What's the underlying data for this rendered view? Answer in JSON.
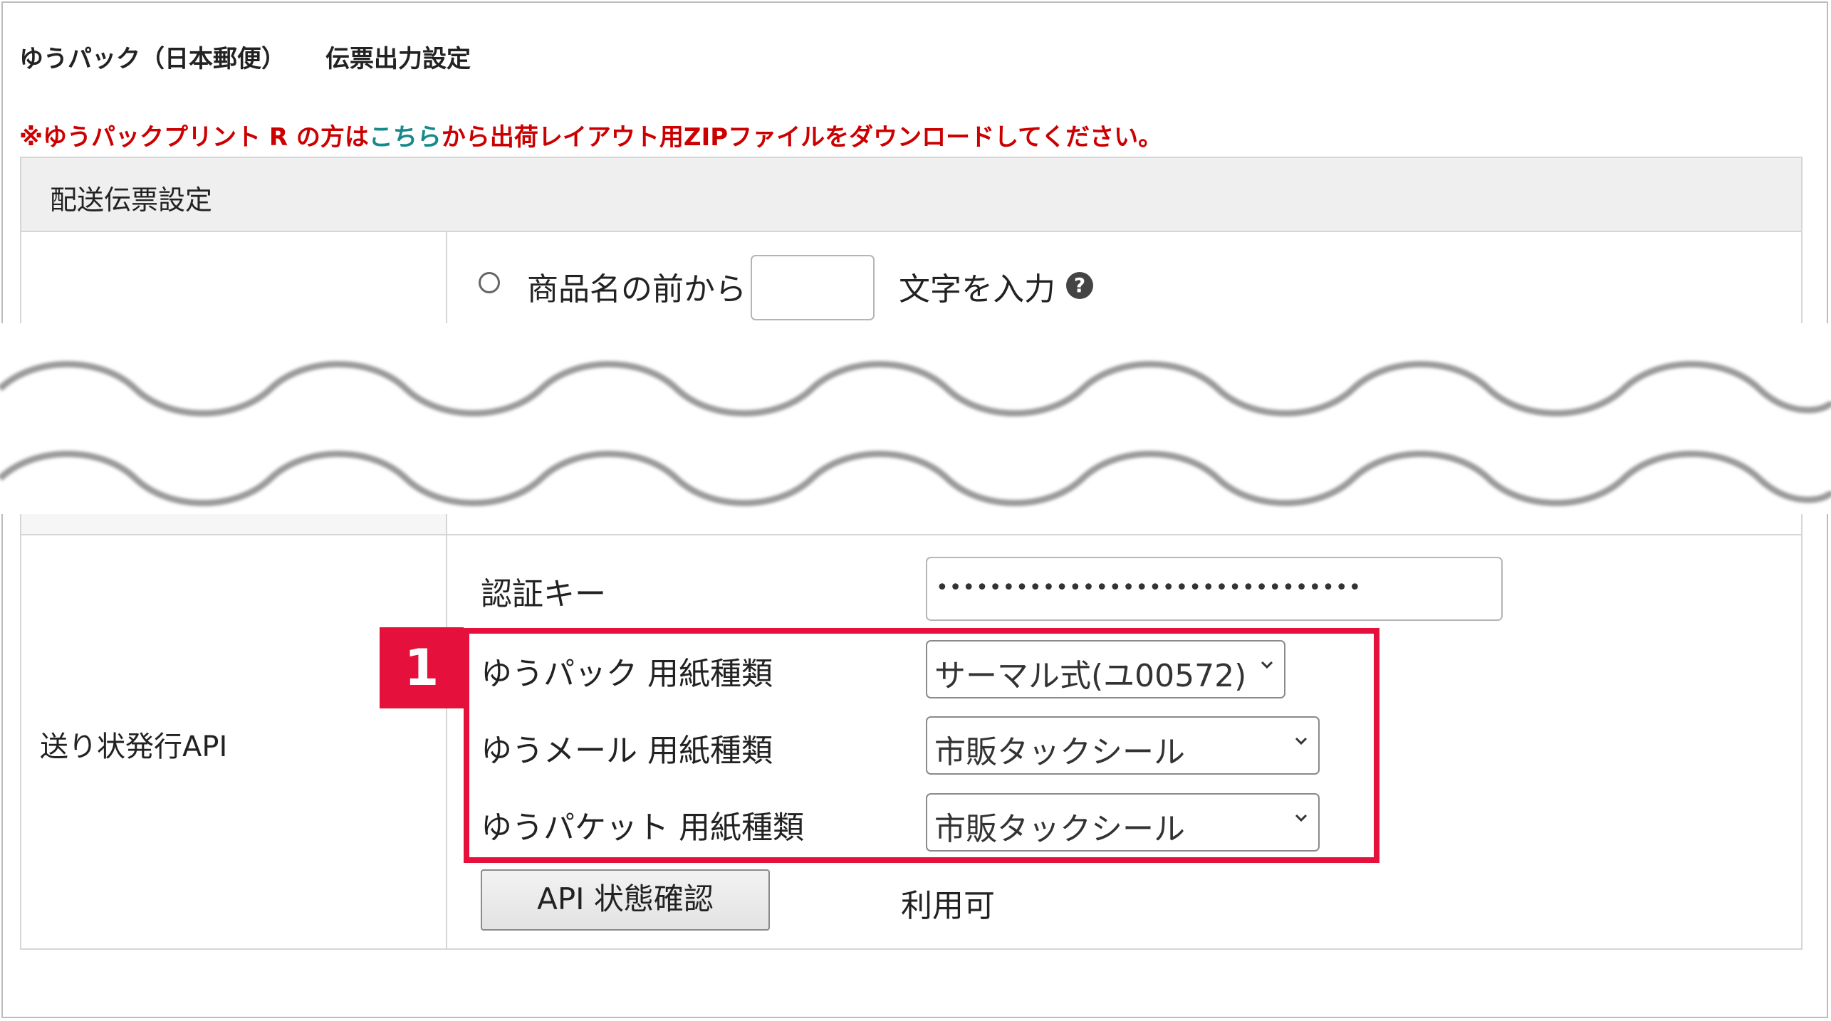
{
  "header": {
    "title_part1": "ゆうパック（日本郵便）",
    "title_part2": "伝票出力設定"
  },
  "notice": {
    "before_link": "※ゆうパックプリント R の方は",
    "link_text": "こちら",
    "after_link": "から出荷レイアウト用ZIPファイルをダウンロードしてください。"
  },
  "section": {
    "title": "配送伝票設定"
  },
  "product_name_row": {
    "prefix": "商品名の前から",
    "input_value": "",
    "suffix": "文字を入力"
  },
  "api_row": {
    "label": "送り状発行API",
    "auth_key_label": "認証キー",
    "auth_key_value": "••••••••••••••••••••••••••••••••",
    "paper_fields": [
      {
        "label": "ゆうパック 用紙種類",
        "selected": "サーマル式(ユ00572)"
      },
      {
        "label": "ゆうメール 用紙種類",
        "selected": "市販タックシール"
      },
      {
        "label": "ゆうパケット 用紙種類",
        "selected": "市販タックシール"
      }
    ],
    "check_button": "API 状態確認",
    "status": "利用可"
  },
  "annotation": {
    "badge": "1",
    "color": "#e5103b"
  },
  "colors": {
    "notice_red": "#cc0000",
    "link_teal": "#168a8a",
    "section_bg": "#efefef"
  }
}
